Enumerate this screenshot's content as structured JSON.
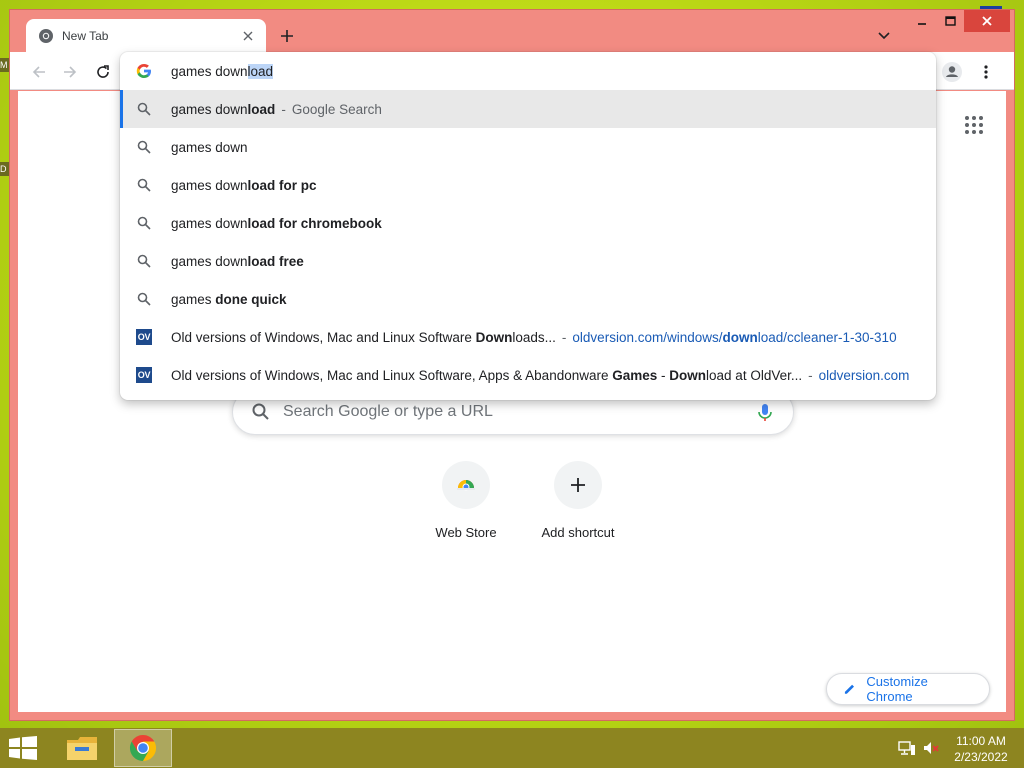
{
  "desktop": {
    "edge_labels": [
      "M",
      "D"
    ]
  },
  "browser": {
    "tab": {
      "title": "New Tab"
    },
    "omnibox": {
      "typed": "games down",
      "autocomplete": "load",
      "suggestions": [
        {
          "type": "search",
          "parts": [
            {
              "t": "games down",
              "b": false
            },
            {
              "t": "load",
              "b": true
            }
          ],
          "description": "Google Search",
          "selected": true
        },
        {
          "type": "search",
          "parts": [
            {
              "t": "games down",
              "b": false
            }
          ]
        },
        {
          "type": "search",
          "parts": [
            {
              "t": "games down",
              "b": false
            },
            {
              "t": "load for pc",
              "b": true
            }
          ]
        },
        {
          "type": "search",
          "parts": [
            {
              "t": "games down",
              "b": false
            },
            {
              "t": "load for chromebook",
              "b": true
            }
          ]
        },
        {
          "type": "search",
          "parts": [
            {
              "t": "games down",
              "b": false
            },
            {
              "t": "load free",
              "b": true
            }
          ]
        },
        {
          "type": "search",
          "parts": [
            {
              "t": "games ",
              "b": false
            },
            {
              "t": "done quick",
              "b": true
            }
          ]
        },
        {
          "type": "site",
          "favicon_text": "OV",
          "parts": [
            {
              "t": "Old versions of Windows, Mac and Linux Software ",
              "b": false
            },
            {
              "t": "Down",
              "b": true
            },
            {
              "t": "loads...",
              "b": false
            }
          ],
          "url_parts": [
            {
              "t": "oldversion.com/windows/",
              "b": false
            },
            {
              "t": "down",
              "b": true
            },
            {
              "t": "load/ccleaner-1-30-310",
              "b": false
            }
          ]
        },
        {
          "type": "site",
          "favicon_text": "OV",
          "parts": [
            {
              "t": "Old versions of Windows, Mac and Linux Software, Apps & Abandonware ",
              "b": false
            },
            {
              "t": "Games",
              "b": true
            },
            {
              "t": " - ",
              "b": false
            },
            {
              "t": "Down",
              "b": true
            },
            {
              "t": "load at OldVer...",
              "b": false
            }
          ],
          "url_parts": [
            {
              "t": "oldversion.com",
              "b": false
            }
          ]
        }
      ]
    },
    "ntp": {
      "search_placeholder": "Search Google or type a URL",
      "shortcuts": [
        {
          "label": "Web Store",
          "icon": "web-store-icon"
        },
        {
          "label": "Add shortcut",
          "icon": "plus-icon"
        }
      ],
      "customize_label": "Customize Chrome"
    },
    "colors": {
      "frame": "#f28b82",
      "accent": "#1a73e8",
      "selected_row": "#e8e8e8"
    }
  },
  "taskbar": {
    "time": "11:00 AM",
    "date": "2/23/2022",
    "apps": [
      "file-explorer-icon",
      "chrome-icon"
    ]
  }
}
